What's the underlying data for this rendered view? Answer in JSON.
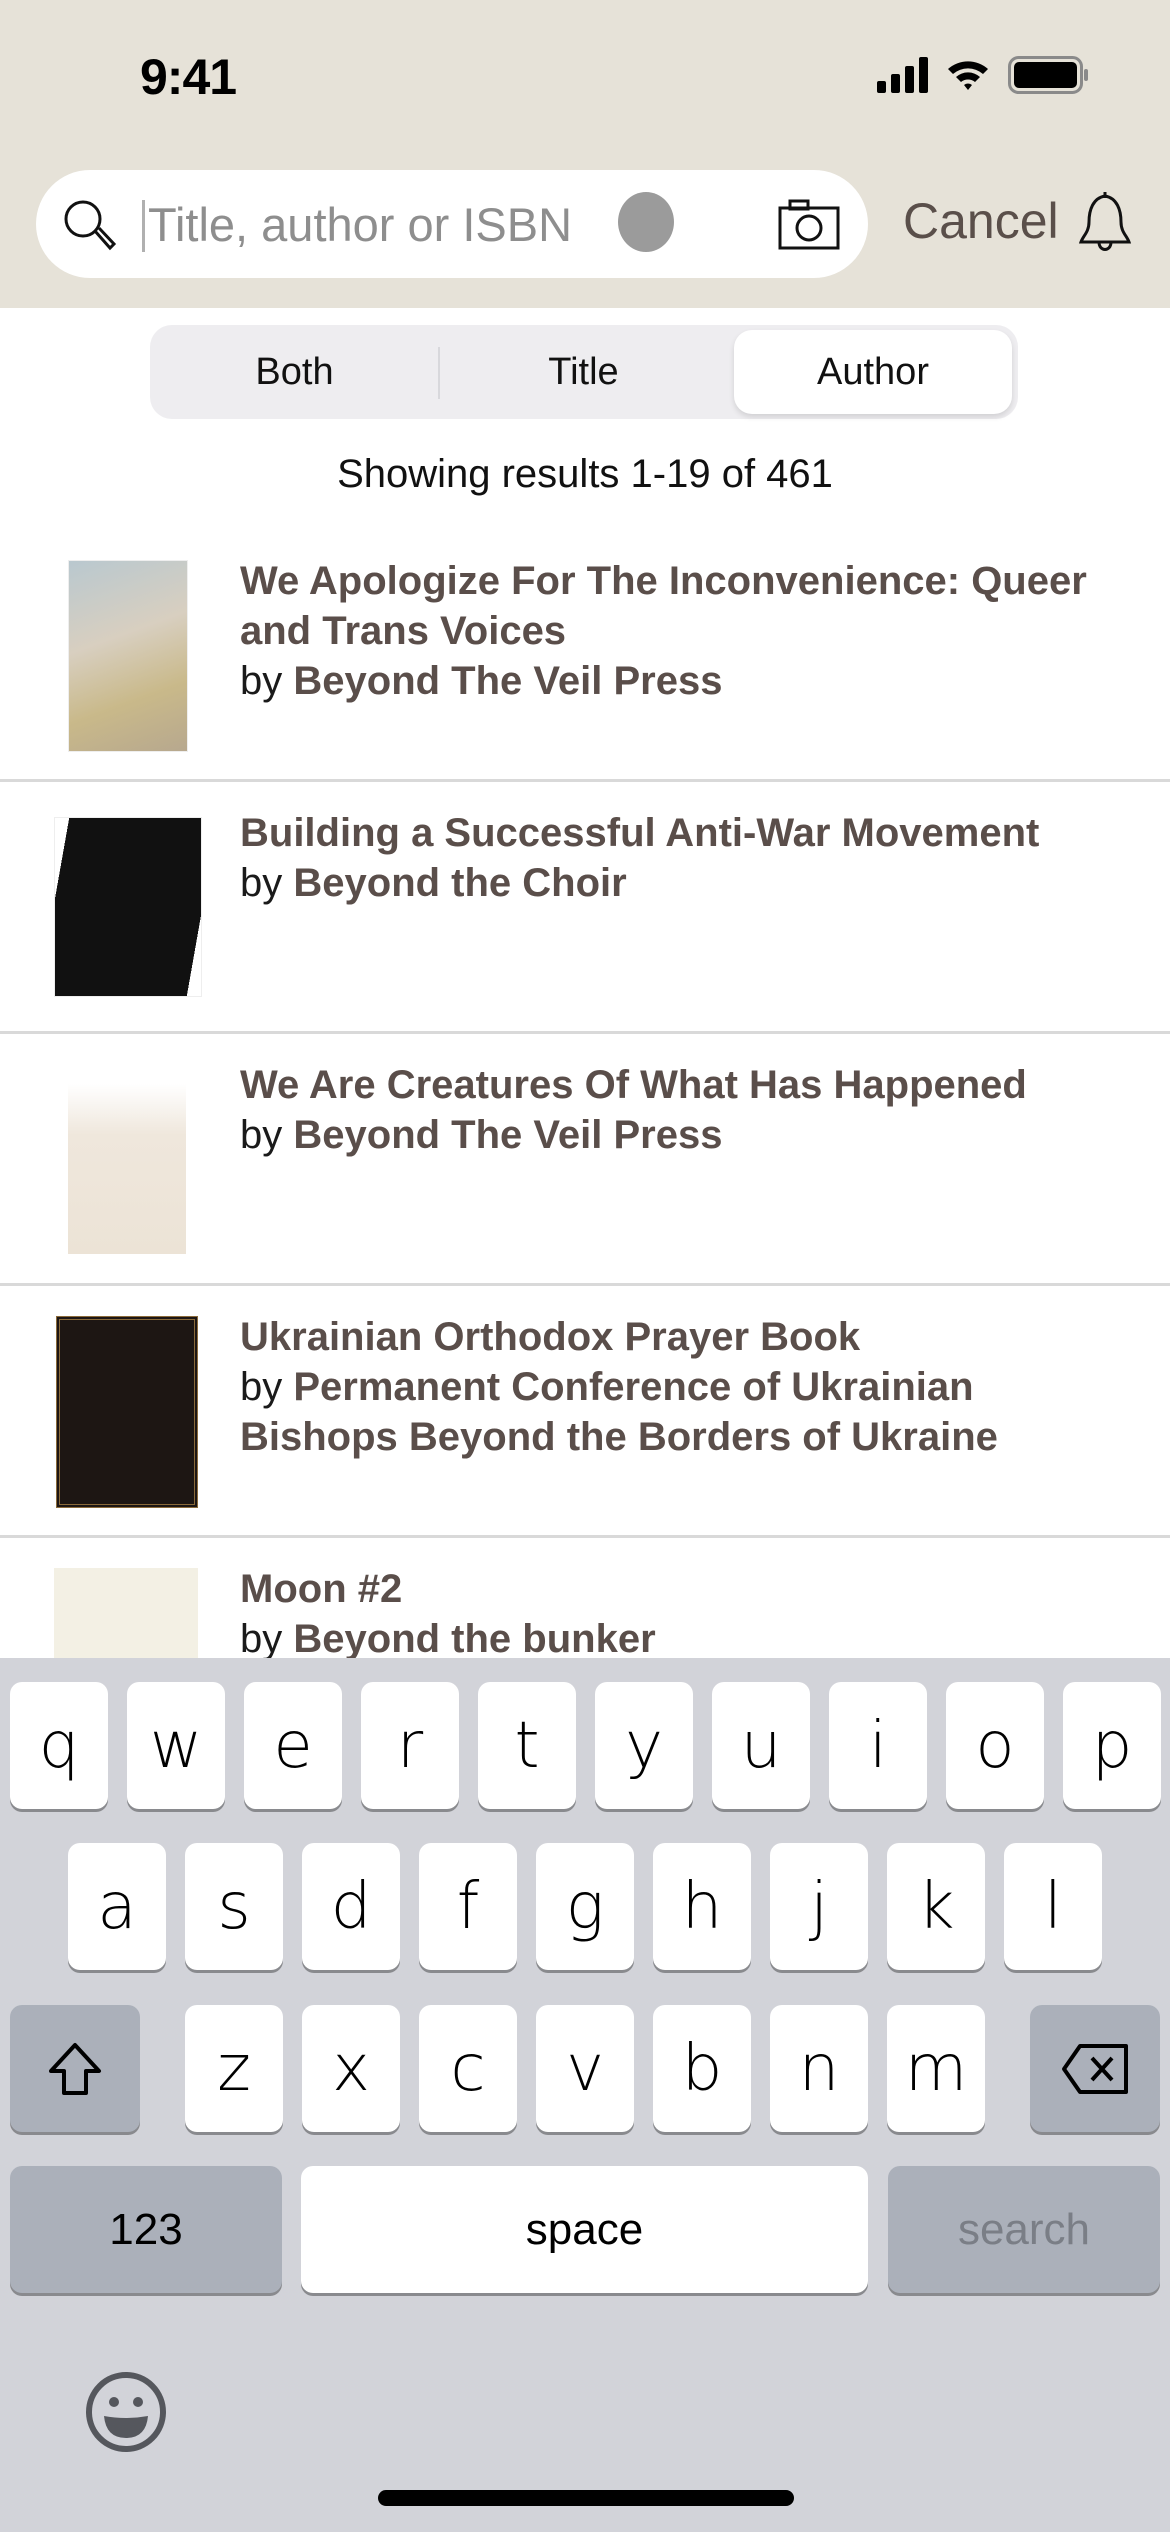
{
  "status_bar": {
    "time": "9:41"
  },
  "search": {
    "placeholder": "Title, author or ISBN",
    "value": "",
    "cancel_label": "Cancel"
  },
  "segments": [
    {
      "label": "Both",
      "selected": false
    },
    {
      "label": "Title",
      "selected": false
    },
    {
      "label": "Author",
      "selected": true
    }
  ],
  "results": {
    "summary": "Showing results 1-19 of 461",
    "by_prefix": "by",
    "items": [
      {
        "title": "We Apologize For The Inconvenience: Queer and Trans Voices",
        "author": "Beyond The Veil Press",
        "cover": "book-cover-we-apologize"
      },
      {
        "title": "Building a Successful Anti-War Movement",
        "author": "Beyond the Choir",
        "cover": "book-cover-building-anti-war"
      },
      {
        "title": "We Are Creatures Of What Has Happened",
        "author": "Beyond The Veil Press",
        "cover": "book-cover-we-are-creatures"
      },
      {
        "title": "Ukrainian Orthodox Prayer Book",
        "author": "Permanent Conference of Ukrainian Bishops Beyond the Borders of Ukraine",
        "cover": "book-cover-prayer-book"
      },
      {
        "title": "Moon #2",
        "author": "Beyond the bunker",
        "cover": "book-cover-placeholder"
      }
    ]
  },
  "keyboard": {
    "row1": [
      "q",
      "w",
      "e",
      "r",
      "t",
      "y",
      "u",
      "i",
      "o",
      "p"
    ],
    "row2": [
      "a",
      "s",
      "d",
      "f",
      "g",
      "h",
      "j",
      "k",
      "l"
    ],
    "row3": [
      "z",
      "x",
      "c",
      "v",
      "b",
      "n",
      "m"
    ],
    "numbers_label": "123",
    "space_label": "space",
    "search_label": "search"
  },
  "colors": {
    "header_bg": "#e6e2d8",
    "title_text": "#5a4e4a",
    "keyboard_bg": "#d2d3d9"
  }
}
